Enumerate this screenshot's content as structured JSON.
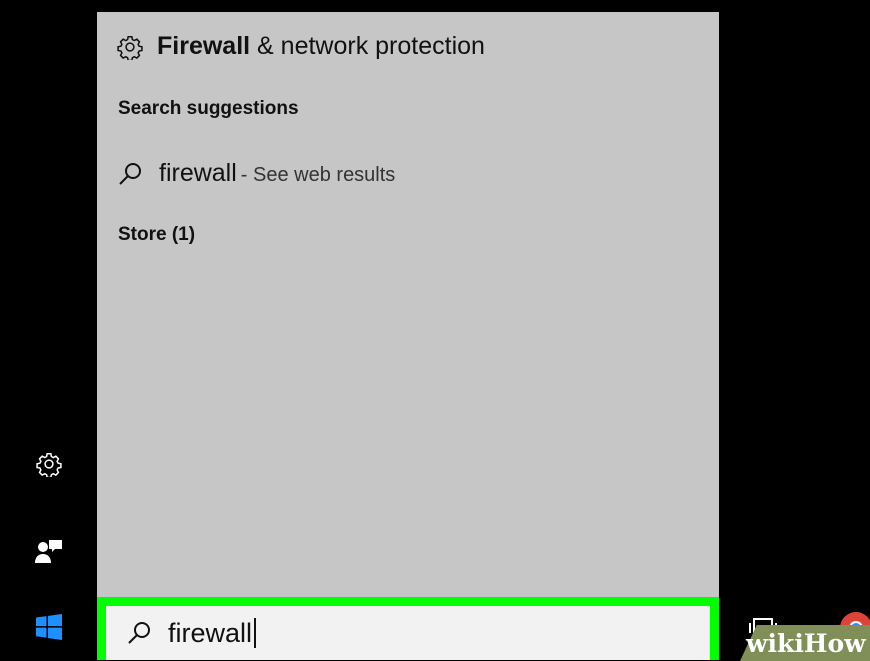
{
  "top_result": {
    "icon": "gear-icon",
    "title_bold": "Firewall",
    "title_rest": " & network protection"
  },
  "sections": {
    "suggestions_header": "Search suggestions",
    "store_header": "Store (1)"
  },
  "suggestion": {
    "icon": "search-icon",
    "term": "firewall",
    "hint": "- See web results"
  },
  "search_box": {
    "icon": "search-icon",
    "value": "firewall",
    "highlight_color": "#00ff00"
  },
  "left_rail": {
    "items": [
      "gear-icon",
      "feedback-icon",
      "windows-start-icon"
    ]
  },
  "watermark": {
    "text": "wikiHow"
  },
  "colors": {
    "panel_bg": "#c6c6c6",
    "taskbar_bg": "#000000",
    "windows_logo": "#1e90ff"
  }
}
